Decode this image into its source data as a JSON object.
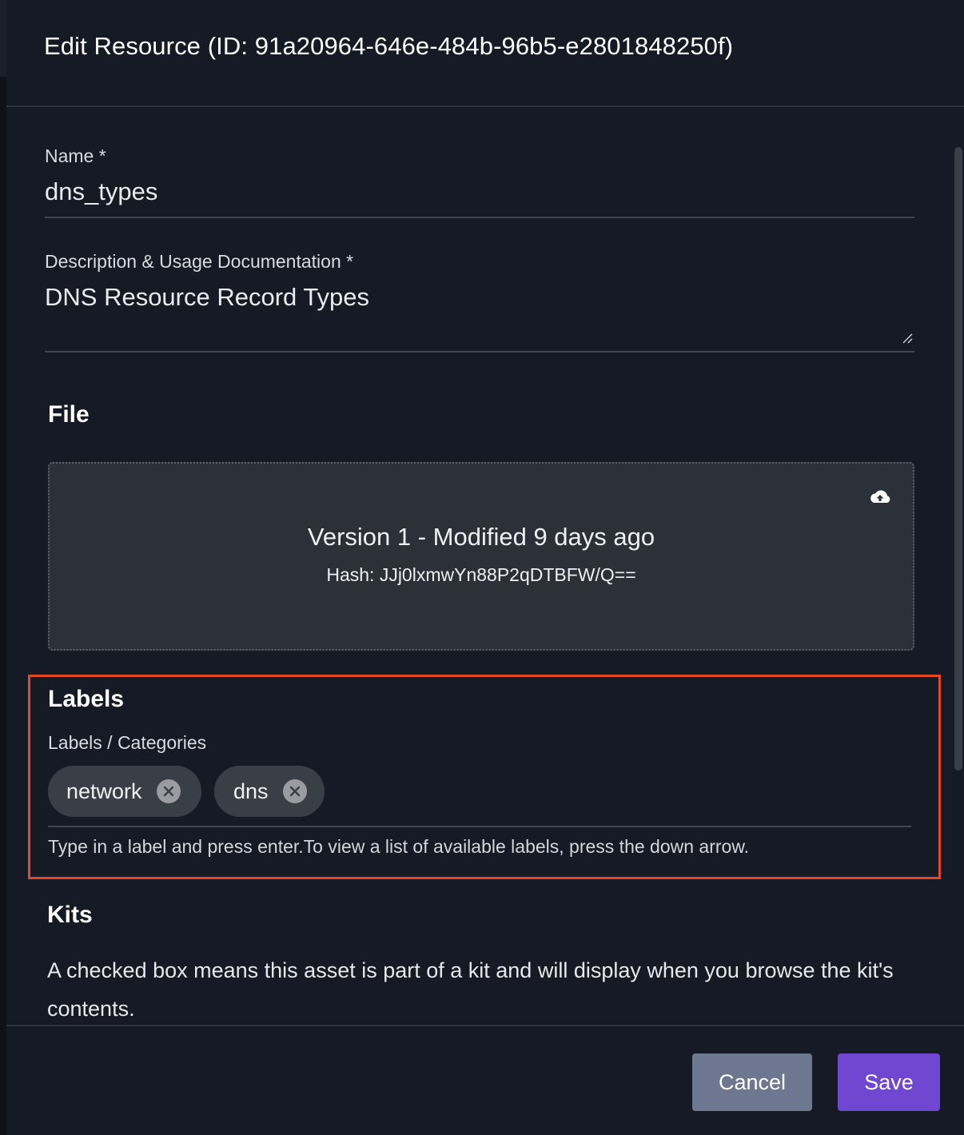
{
  "dialog": {
    "title": "Edit Resource (ID: 91a20964-646e-484b-96b5-e2801848250f)"
  },
  "name_field": {
    "label": "Name *",
    "value": "dns_types"
  },
  "description_field": {
    "label": "Description & Usage Documentation *",
    "value": "DNS Resource Record Types"
  },
  "file_section": {
    "title": "File",
    "version_text": "Version 1 - Modified 9 days ago",
    "hash_text": "Hash: JJj0lxmwYn88P2qDTBFW/Q==",
    "upload_icon": "cloud-upload-icon"
  },
  "labels_section": {
    "title": "Labels",
    "field_label": "Labels / Categories",
    "chips": [
      {
        "label": "network",
        "remove_icon": "close-circle-icon"
      },
      {
        "label": "dns",
        "remove_icon": "close-circle-icon"
      }
    ],
    "helper_text": "Type in a label and press enter.To view a list of available labels, press the down arrow.",
    "highlight_color": "#e24a2a"
  },
  "kits_section": {
    "title": "Kits",
    "description": "A checked box means this asset is part of a kit and will display when you browse the kit's contents."
  },
  "footer": {
    "cancel_label": "Cancel",
    "save_label": "Save",
    "save_color": "#7047d1",
    "cancel_color": "#6d7890"
  }
}
